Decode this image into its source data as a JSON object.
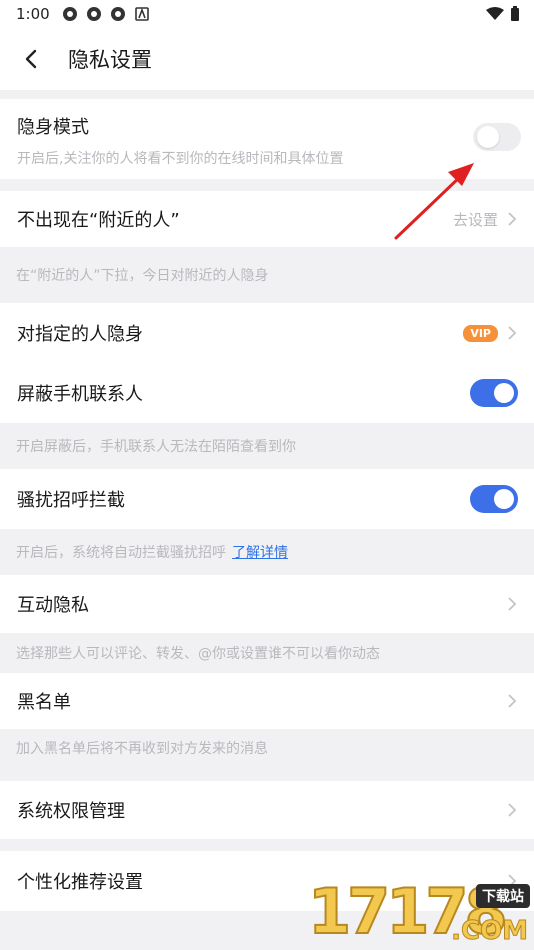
{
  "status_bar": {
    "time": "1:00"
  },
  "header": {
    "title": "隐私设置"
  },
  "stealth": {
    "label": "隐身模式",
    "desc": "开启后,关注你的人将看不到你的在线时间和具体位置",
    "enabled": false
  },
  "nearby": {
    "label": "不出现在“附近的人”",
    "action": "去设置",
    "hint": "在“附近的人”下拉，今日对附近的人隐身"
  },
  "specific_hide": {
    "label": "对指定的人隐身",
    "badge": "VIP"
  },
  "block_contacts": {
    "label": "屏蔽手机联系人",
    "enabled": true,
    "hint": "开启屏蔽后，手机联系人无法在陌陌查看到你"
  },
  "harass_block": {
    "label": "骚扰招呼拦截",
    "enabled": true,
    "hint": "开启后，系统将自动拦截骚扰招呼",
    "link": "了解详情"
  },
  "interaction_privacy": {
    "label": "互动隐私",
    "hint": "选择那些人可以评论、转发、@你或设置谁不可以看你动态"
  },
  "blacklist": {
    "label": "黑名单",
    "hint": "加入黑名单后将不再收到对方发来的消息"
  },
  "system_permissions": {
    "label": "系统权限管理"
  },
  "personalized": {
    "label": "个性化推荐设置"
  },
  "watermark": {
    "number": "17178",
    "tag": "下载站",
    "suffix": ".COM"
  },
  "colors": {
    "accent": "#3c6fe8",
    "vip": "#f6913a",
    "annotation_arrow": "#e02020"
  }
}
